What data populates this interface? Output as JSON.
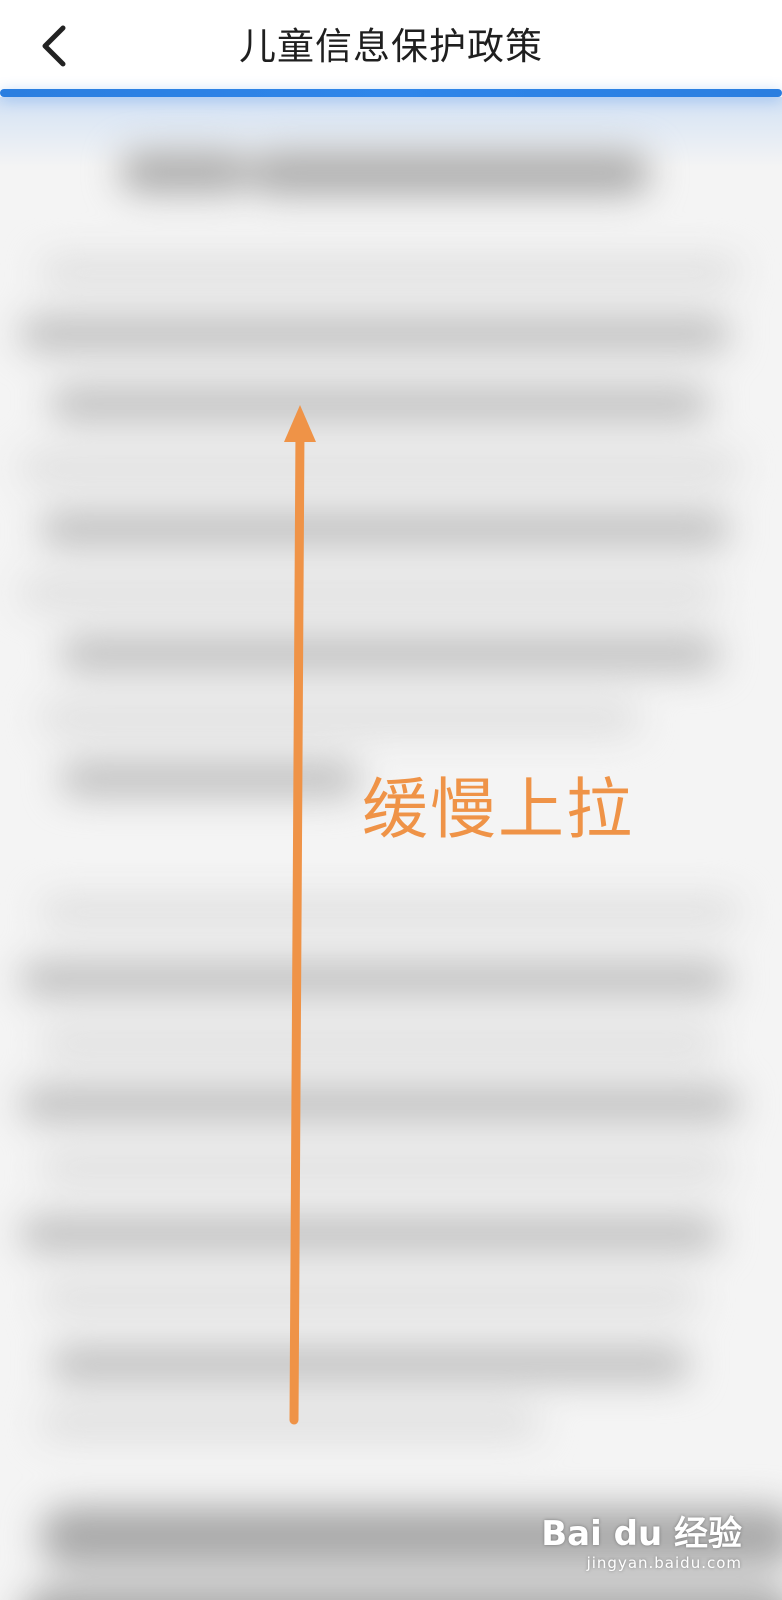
{
  "header": {
    "title": "儿童信息保护政策",
    "back_icon": "chevron-left-icon"
  },
  "annotation": {
    "instruction": "缓慢上拉",
    "arrow_icon": "arrow-up-icon",
    "color": "#ef9347"
  },
  "watermark": {
    "main": "Bai du 经验",
    "sub": "jingyan.baidu.com"
  },
  "colors": {
    "accent_blue": "#2a7ee0",
    "annotation_orange": "#ef9347"
  }
}
